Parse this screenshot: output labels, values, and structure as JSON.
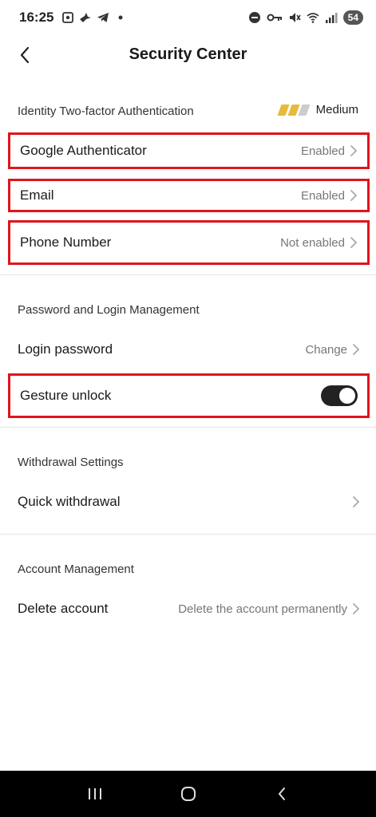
{
  "status_bar": {
    "time": "16:25",
    "battery": "54"
  },
  "header": {
    "title": "Security Center"
  },
  "two_factor": {
    "section_label": "Identity Two-factor Authentication",
    "strength_label": "Medium",
    "strength_level": 2,
    "strength_total": 3,
    "items": [
      {
        "label": "Google Authenticator",
        "value": "Enabled"
      },
      {
        "label": "Email",
        "value": "Enabled"
      },
      {
        "label": "Phone Number",
        "value": "Not enabled"
      }
    ]
  },
  "password": {
    "section_label": "Password and Login Management",
    "login_password": {
      "label": "Login password",
      "value": "Change"
    },
    "gesture_unlock": {
      "label": "Gesture unlock",
      "enabled": true
    }
  },
  "withdrawal": {
    "section_label": "Withdrawal Settings",
    "quick_withdrawal": {
      "label": "Quick withdrawal"
    }
  },
  "account": {
    "section_label": "Account Management",
    "delete_account": {
      "label": "Delete account",
      "value": "Delete the account permanently"
    }
  },
  "colors": {
    "highlight": "#e0141c",
    "strength_active": "#e8b93a",
    "strength_inactive": "#cccccc"
  }
}
